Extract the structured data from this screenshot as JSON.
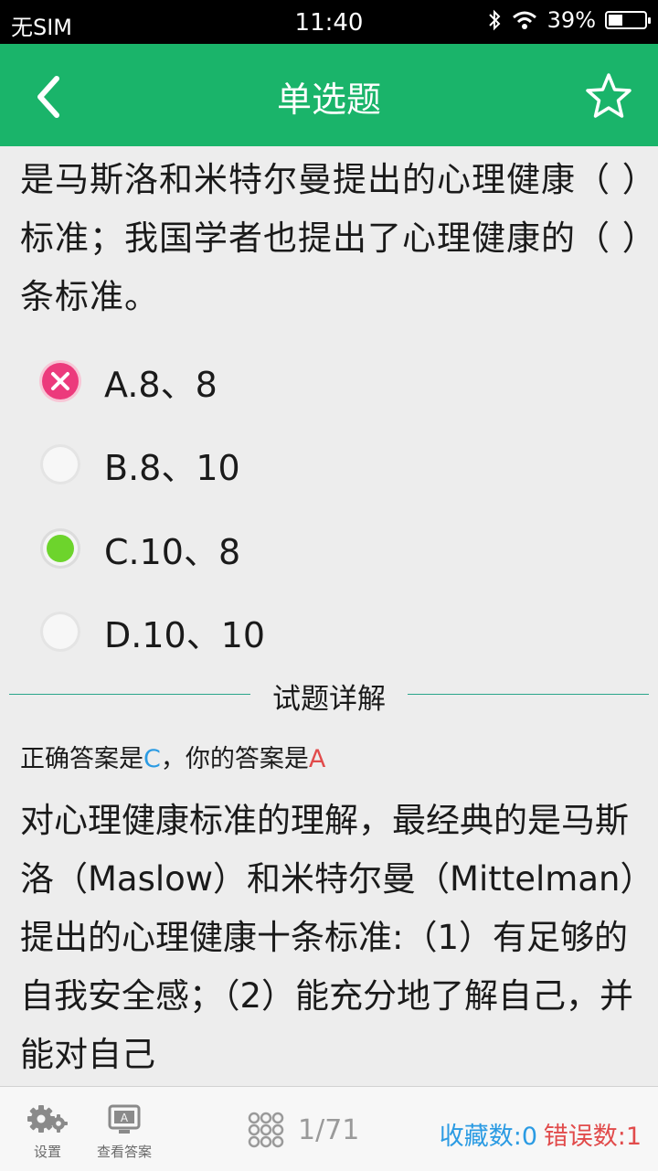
{
  "status_bar": {
    "carrier": "无SIM",
    "time": "11:40",
    "battery": "39%",
    "battery_level": 0.39
  },
  "header": {
    "title": "单选题",
    "back_icon": "chevron-left-icon",
    "star_icon": "star-outline-icon"
  },
  "question": {
    "text": "是马斯洛和米特尔曼提出的心理健康（ ）标准；我国学者也提出了心理健康的（ ）条标准。"
  },
  "options": [
    {
      "label": "A.8、8",
      "state": "wrong"
    },
    {
      "label": "B.8、10",
      "state": "empty"
    },
    {
      "label": "C.10、8",
      "state": "correct"
    },
    {
      "label": "D.10、10",
      "state": "empty"
    }
  ],
  "detail": {
    "divider_label": "试题详解",
    "answer_prefix": "正确答案是",
    "correct_answer": "C",
    "answer_mid": "，你的答案是",
    "user_answer": "A",
    "explanation": "对心理健康标准的理解，最经典的是马斯洛（Maslow）和米特尔曼（Mittelman）提出的心理健康十条标准:（1）有足够的自我安全感；（2）能充分地了解自己，并能对自己"
  },
  "bottom_bar": {
    "settings_label": "设置",
    "answers_label": "查看答案",
    "page_counter": "1/71",
    "favorites": "收藏数:0",
    "errors": "错误数:1"
  },
  "colors": {
    "header": "#1ab46a",
    "correct_blue": "#2b9be3",
    "error_red": "#e14b4b",
    "wrong_pink": "#ec3a7c",
    "right_green": "#6dd42c"
  }
}
